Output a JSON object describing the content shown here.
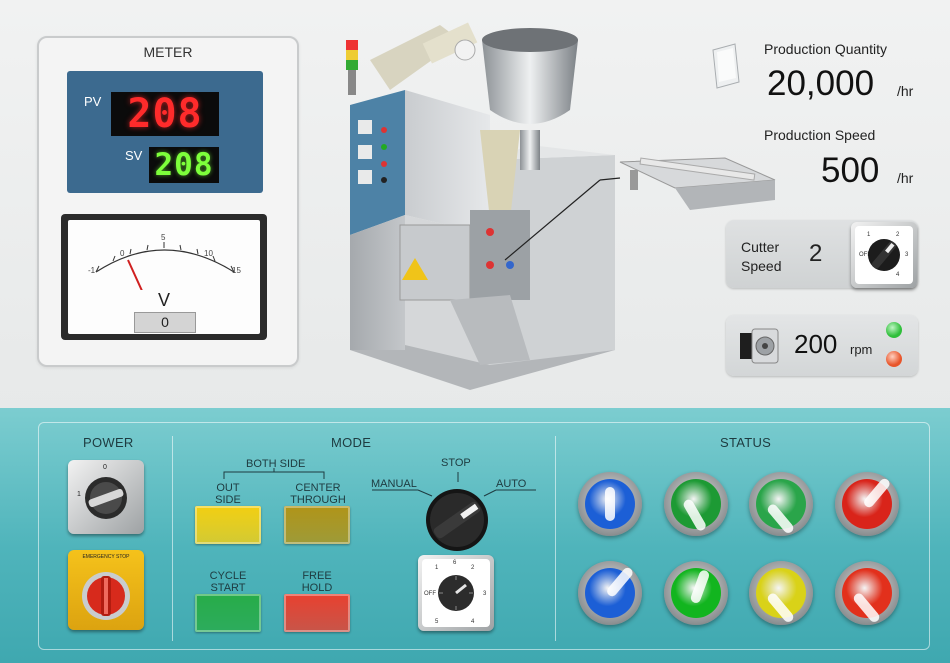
{
  "meter": {
    "title": "METER",
    "pv_label": "PV",
    "pv_value": "208",
    "sv_label": "SV",
    "sv_value": "208",
    "voltmeter": {
      "unit": "V",
      "value": "0",
      "scale_labels": [
        "-1",
        "0",
        "5",
        "10",
        "15"
      ]
    }
  },
  "production": {
    "quantity_label": "Production Quantity",
    "quantity_value": "20,000",
    "quantity_unit": "/hr",
    "speed_label": "Production Speed",
    "speed_value": "500",
    "speed_unit": "/hr"
  },
  "cutter": {
    "label_line1": "Cutter",
    "label_line2": "Speed",
    "value": "2",
    "dial_labels": [
      "OFF",
      "1",
      "2",
      "3",
      "4"
    ]
  },
  "motor": {
    "value": "200",
    "unit": "rpm",
    "indicator_colors": [
      "#2fbf3a",
      "#e8552a"
    ]
  },
  "power": {
    "title": "POWER",
    "switch_labels": [
      "0",
      "1"
    ],
    "emergency_label": "EMERGENCY STOP"
  },
  "mode": {
    "title": "MODE",
    "both_side_label": "BOTH SIDE",
    "buttons": [
      {
        "line1": "OUT",
        "line2": "SIDE",
        "color": "#f2cf12"
      },
      {
        "line1": "CENTER",
        "line2": "THROUGH",
        "color": "#b09418"
      },
      {
        "line1": "CYCLE",
        "line2": "START",
        "color": "#27ac48"
      },
      {
        "line1": "FREE",
        "line2": "HOLD",
        "color": "#e8402f"
      }
    ],
    "selector": {
      "manual": "MANUAL",
      "stop": "STOP",
      "auto": "AUTO"
    },
    "speed_dial_labels": [
      "OFF",
      "1",
      "2",
      "3",
      "4",
      "5",
      "6"
    ]
  },
  "status": {
    "title": "STATUS",
    "lights_row1": [
      "#1c5fd6",
      "#1d9a34",
      "#2aa54a",
      "#d9241a"
    ],
    "lights_row2": [
      "#1c5fd6",
      "#12b51f",
      "#d9d218",
      "#e2301c"
    ]
  }
}
